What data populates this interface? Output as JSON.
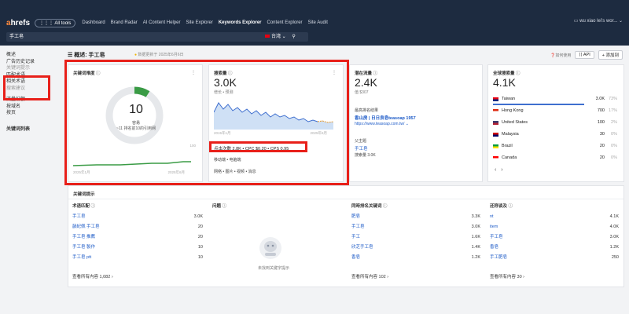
{
  "app": {
    "logo_a": "a",
    "logo_rest": "hrefs",
    "all_tools": "All tools",
    "user": "wu xiao lei's wor..."
  },
  "nav": [
    "Dashboard",
    "Brand Radar",
    "AI Content Helper",
    "Site Explorer",
    "Keywords Explorer",
    "Content Explorer",
    "Site Audit"
  ],
  "search": {
    "value": "手工皂",
    "country": "台湾"
  },
  "sidebar": {
    "top": [
      "概述",
      "广告历史记录",
      "关键词提示"
    ],
    "mid": [
      "匹配术语",
      "相关术语",
      "搜索建议"
    ],
    "lower": [
      "流量份额",
      "按域名",
      "按页"
    ],
    "bottom": [
      "关键词列表"
    ]
  },
  "title": {
    "text": "概述: 手工皂",
    "sub": "数据更新于 2025年6月6日",
    "howto": "如何使用",
    "api": "API",
    "add": "+ 添加到"
  },
  "kd": {
    "title": "关键词难度",
    "value": "10",
    "label": "容易",
    "note": "~11 排名前10的引用网",
    "y_max": "100",
    "x_start": "2025年1月",
    "x_end": "2025年6月"
  },
  "sv": {
    "title": "搜索量",
    "value": "3.0K",
    "sub": "增长  •  预测",
    "x_start": "2015年1月",
    "x_end": "2025年6月",
    "clicks_line": "点击次数 2.8K • CPC $0.20 • CPS 0.95",
    "device": "移动端  •  电脑端",
    "serp": "网络  •  图片  •  视频  •  消息"
  },
  "tp": {
    "title": "潜在流量",
    "value": "2.4K",
    "sub": "值 $307",
    "top_label": "最高排名结果",
    "top_site": "香山房 | 日日良皂teasoap 1957",
    "top_url": "https://www.teasoap.com.tw/",
    "parent_label": "父主题",
    "parent_topic": "手工皂",
    "parent_vol": "搜索量 3.0K"
  },
  "gv": {
    "title": "全球搜索量",
    "value": "4.1K",
    "countries": [
      {
        "name": "Taiwan",
        "vol": "3.0K",
        "pct": "73%",
        "flag": "tw"
      },
      {
        "name": "Hong Kong",
        "vol": "700",
        "pct": "17%",
        "flag": "hk"
      },
      {
        "name": "United States",
        "vol": "100",
        "pct": "2%",
        "flag": "us"
      },
      {
        "name": "Malaysia",
        "vol": "30",
        "pct": "0%",
        "flag": "my"
      },
      {
        "name": "Brazil",
        "vol": "20",
        "pct": "0%",
        "flag": "br"
      },
      {
        "name": "Canada",
        "vol": "20",
        "pct": "0%",
        "flag": "ca"
      }
    ]
  },
  "ideas": {
    "title": "关键词提示",
    "terms": {
      "header": "术语匹配",
      "rows": [
        [
          "手工皂",
          "3.0K"
        ],
        [
          "韻紀佩 手工皂",
          "20"
        ],
        [
          "手工皂 推薦",
          "20"
        ],
        [
          "手工皂 製作",
          "10"
        ],
        [
          "手工皂 ptt",
          "10"
        ]
      ],
      "more": "查看所有内容 1,082"
    },
    "questions": {
      "header": "问题",
      "empty": "未找到关键字提示"
    },
    "also_rank": {
      "header": "同時排名关键词",
      "rows": [
        [
          "肥皂",
          "3.3K"
        ],
        [
          "手工皂",
          "3.0K"
        ],
        [
          "手工",
          "1.6K"
        ],
        [
          "欣芝手工皂",
          "1.4K"
        ],
        [
          "香皂",
          "1.2K"
        ]
      ],
      "more": "查看所有内容 102"
    },
    "also_talk": {
      "header": "还称谈及",
      "rows": [
        [
          "nt",
          "4.1K"
        ],
        [
          "item",
          "4.0K"
        ],
        [
          "手工皂",
          "3.0K"
        ],
        [
          "香皂",
          "1.2K"
        ],
        [
          "手工肥皂",
          "250"
        ]
      ],
      "more": "查看所有内容 30"
    }
  },
  "colors": {
    "accent": "#ff8a3d",
    "topbar": "#1d2b40",
    "highlight": "#e8201a",
    "link": "#1c5ac7"
  }
}
